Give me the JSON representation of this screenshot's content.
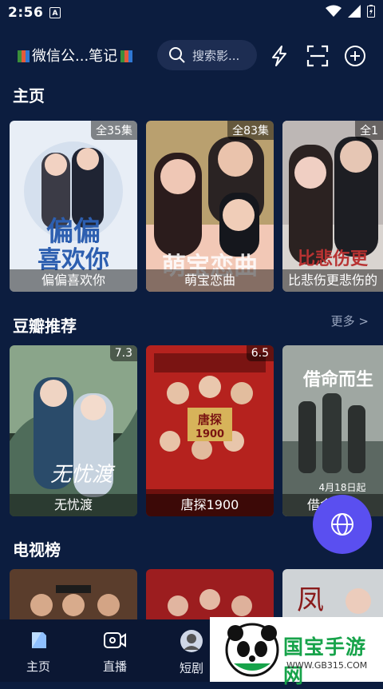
{
  "status": {
    "time": "2:56",
    "notif_letter": "A"
  },
  "header": {
    "title": "微信公...笔记",
    "search_placeholder": "搜索影..."
  },
  "sections": {
    "home": "主页",
    "douban": "豆瓣推荐",
    "douban_more": "更多 >",
    "tv": "电视榜"
  },
  "home_row": [
    {
      "title": "偏偏喜欢你",
      "badge": "全35集"
    },
    {
      "title": "萌宝恋曲",
      "badge": "全83集"
    },
    {
      "title": "比悲伤更悲伤的",
      "badge": "全1"
    }
  ],
  "douban_row": [
    {
      "title": "无忧渡",
      "rating": "7.3"
    },
    {
      "title": "唐探1900",
      "rating": "6.5"
    },
    {
      "title": "借命而生",
      "rating": ""
    }
  ],
  "nav": {
    "home": "主页",
    "live": "直播",
    "short": "短剧"
  },
  "watermark": {
    "brand": "国宝手游网",
    "url": "WWW.GB315.COM"
  }
}
